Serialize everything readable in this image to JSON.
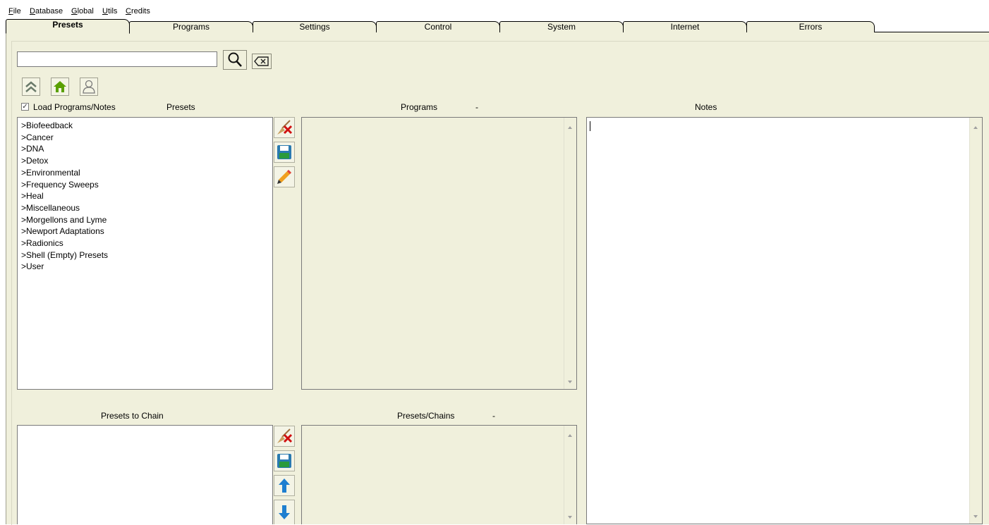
{
  "menu": {
    "items": [
      {
        "first": "F",
        "rest": "ile"
      },
      {
        "first": "D",
        "rest": "atabase"
      },
      {
        "first": "G",
        "rest": "lobal"
      },
      {
        "first": "U",
        "rest": "tils"
      },
      {
        "first": "C",
        "rest": "redits"
      }
    ]
  },
  "tabs": [
    "Presets",
    "Programs",
    "Settings",
    "Control",
    "System",
    "Internet",
    "Errors"
  ],
  "active_tab": "Presets",
  "search": {
    "value": "",
    "placeholder": ""
  },
  "load_checkbox": {
    "label": "Load Programs/Notes",
    "checked": true
  },
  "presets_panel": {
    "title": "Presets",
    "items": [
      ">Biofeedback",
      ">Cancer",
      ">DNA",
      ">Detox",
      ">Environmental",
      ">Frequency Sweeps",
      ">Heal",
      ">Miscellaneous",
      ">Morgellons and Lyme",
      ">Newport Adaptations",
      ">Radionics",
      ">Shell (Empty) Presets",
      ">User"
    ]
  },
  "programs_panel": {
    "title": "Programs",
    "suffix": "-"
  },
  "notes_panel": {
    "title": "Notes",
    "value": ""
  },
  "chain_panel": {
    "title": "Presets to Chain"
  },
  "chains_panel": {
    "title": "Presets/Chains",
    "suffix": "-"
  },
  "colors": {
    "panel_bg": "#f0f0dc",
    "home_green": "#5aa000",
    "arrow_blue": "#1e7fd0",
    "delete_red": "#d01010",
    "save_green": "#2a9a3a"
  }
}
